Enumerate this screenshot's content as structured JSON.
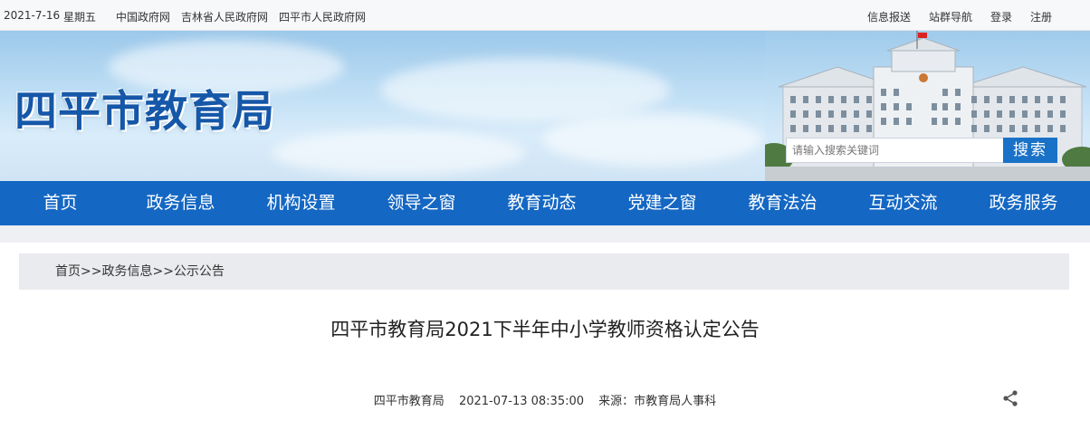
{
  "topbar": {
    "date": "2021-7-16",
    "weekday": "星期五",
    "gov_links": [
      "中国政府网",
      "吉林省人民政府网",
      "四平市人民政府网"
    ],
    "right_links": [
      "信息报送",
      "站群导航",
      "登录",
      "注册"
    ]
  },
  "banner": {
    "title": "四平市教育局"
  },
  "search": {
    "placeholder": "请输入搜索关键词",
    "button": "搜索"
  },
  "nav": {
    "items": [
      "首页",
      "政务信息",
      "机构设置",
      "领导之窗",
      "教育动态",
      "党建之窗",
      "教育法治",
      "互动交流",
      "政务服务"
    ]
  },
  "breadcrumb": {
    "home": "首页",
    "sep": ">>",
    "level1": "政务信息",
    "level2": "公示公告"
  },
  "article": {
    "title": "四平市教育局2021下半年中小学教师资格认定公告",
    "publisher": "四平市教育局",
    "datetime": "2021-07-13 08:35:00",
    "source": "来源：市教育局人事科"
  },
  "colors": {
    "nav_bg": "#1467c3",
    "title_blue": "#1557a8",
    "search_btn": "#1a72c8"
  },
  "icons": {
    "share": "share-icon"
  }
}
